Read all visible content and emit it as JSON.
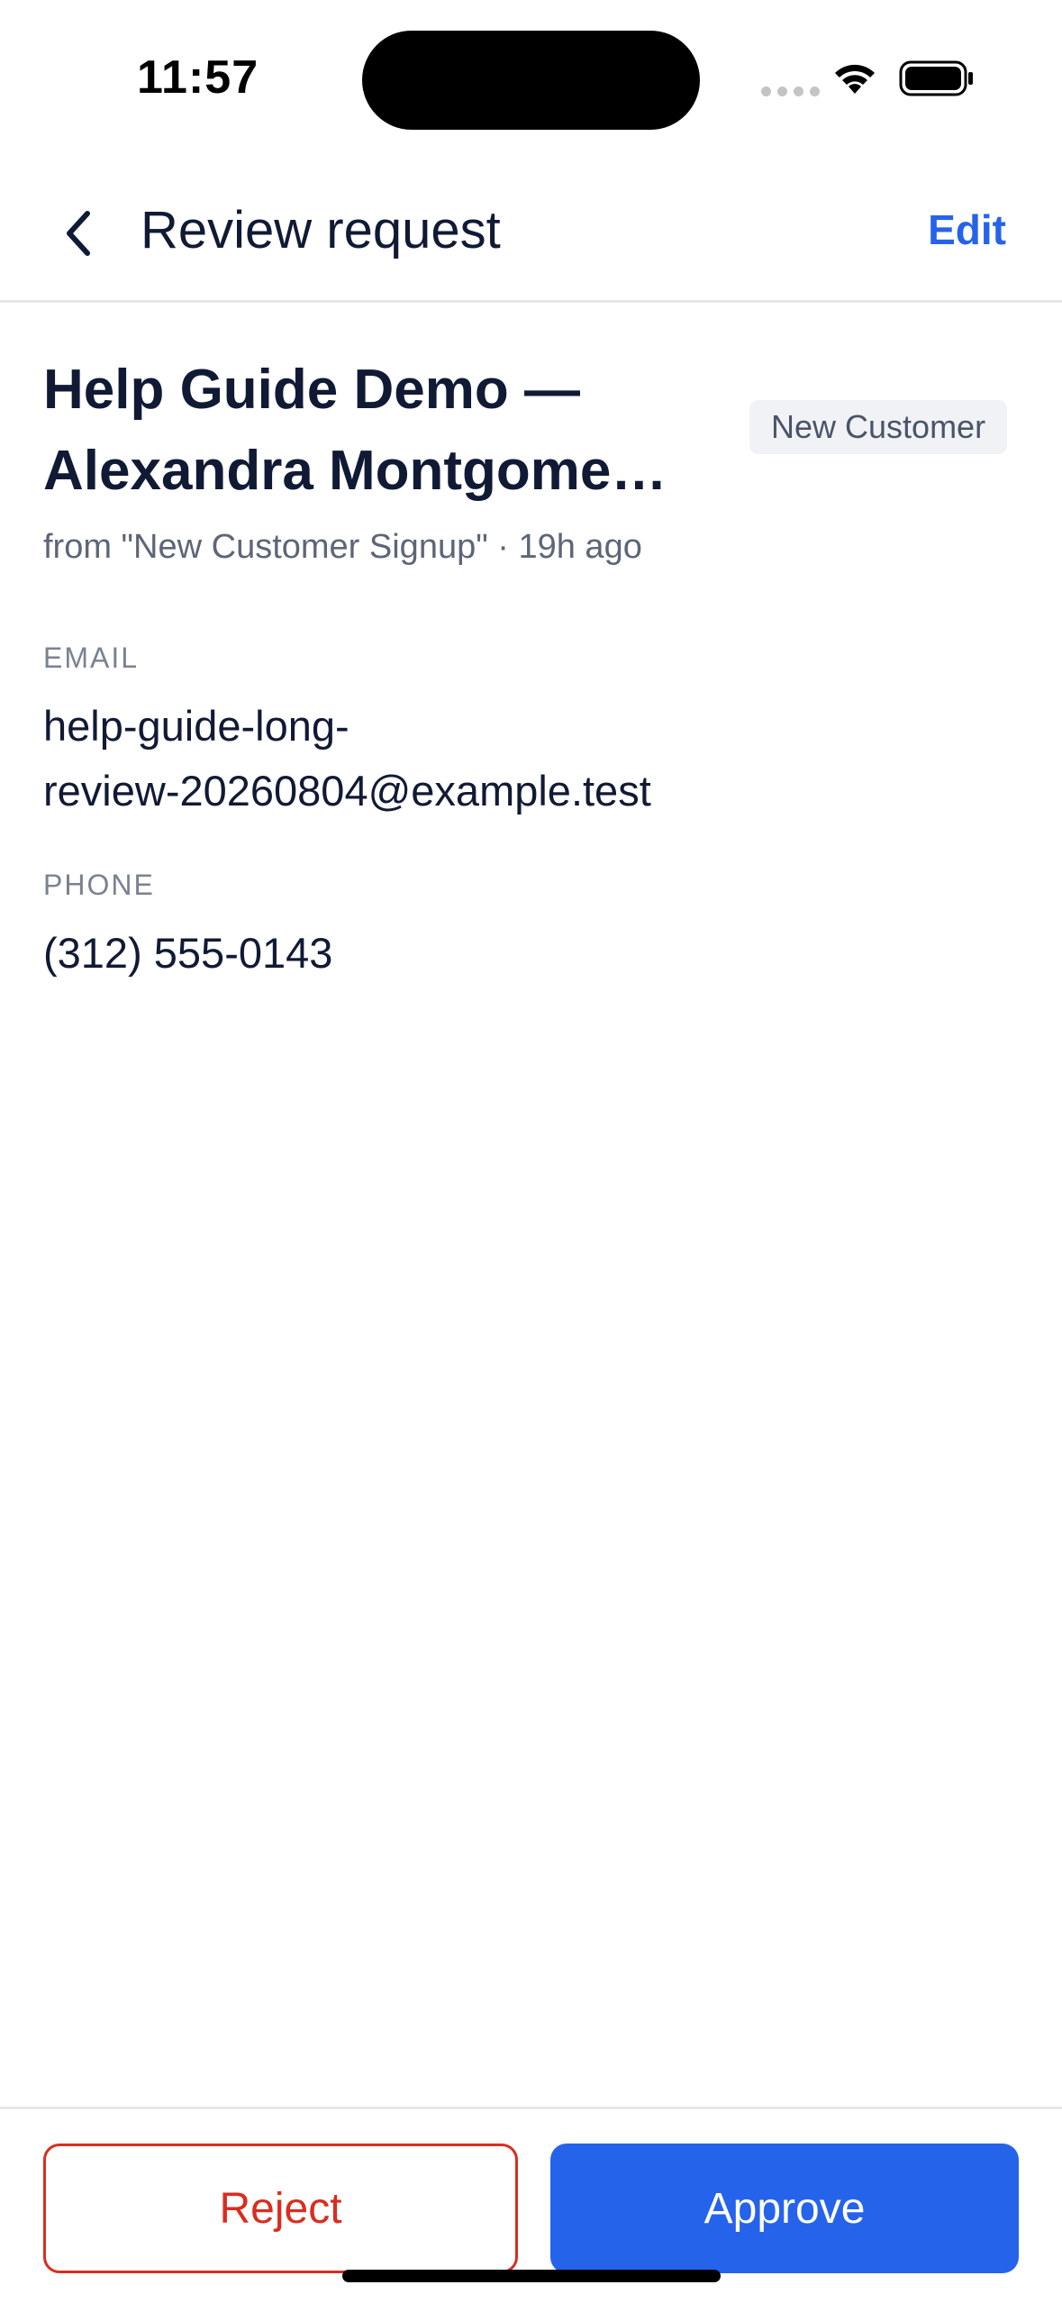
{
  "status_bar": {
    "time": "11:57"
  },
  "nav": {
    "title": "Review request",
    "edit_label": "Edit",
    "back_icon": "chevron-left-icon"
  },
  "request": {
    "title_line1": "Help Guide Demo —",
    "title_line2": "Alexandra Montgome…",
    "tag": "New Customer",
    "meta": "from \"New Customer Signup\" · 19h ago"
  },
  "fields": {
    "email_label": "EMAIL",
    "email_value": "help-guide-long-review-20260804@example.test",
    "email_line1": "help-guide-long-",
    "email_line2": "review-20260804@example.test",
    "phone_label": "PHONE",
    "phone_value": "(312) 555-0143"
  },
  "actions": {
    "reject_label": "Reject",
    "approve_label": "Approve"
  },
  "colors": {
    "accent": "#2563eb",
    "danger": "#d92d20",
    "text": "#111a35",
    "muted": "#5d6677"
  }
}
